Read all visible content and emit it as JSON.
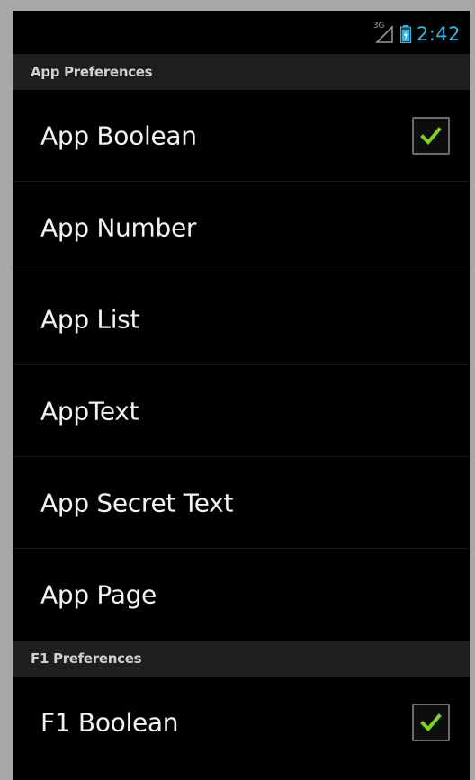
{
  "status_bar": {
    "network": "3G",
    "time": "2:42"
  },
  "colors": {
    "clock": "#33b5e5",
    "checkmark": "#7ed321",
    "header_bg": "#1e1e1e"
  },
  "sections": [
    {
      "title": "App Preferences",
      "items": [
        {
          "label": "App Boolean",
          "type": "checkbox",
          "checked": true
        },
        {
          "label": "App Number",
          "type": "item"
        },
        {
          "label": "App List",
          "type": "item"
        },
        {
          "label": "AppText",
          "type": "item"
        },
        {
          "label": "App Secret Text",
          "type": "item"
        },
        {
          "label": "App Page",
          "type": "item"
        }
      ]
    },
    {
      "title": "F1 Preferences",
      "items": [
        {
          "label": "F1 Boolean",
          "type": "checkbox",
          "checked": true
        }
      ]
    }
  ]
}
